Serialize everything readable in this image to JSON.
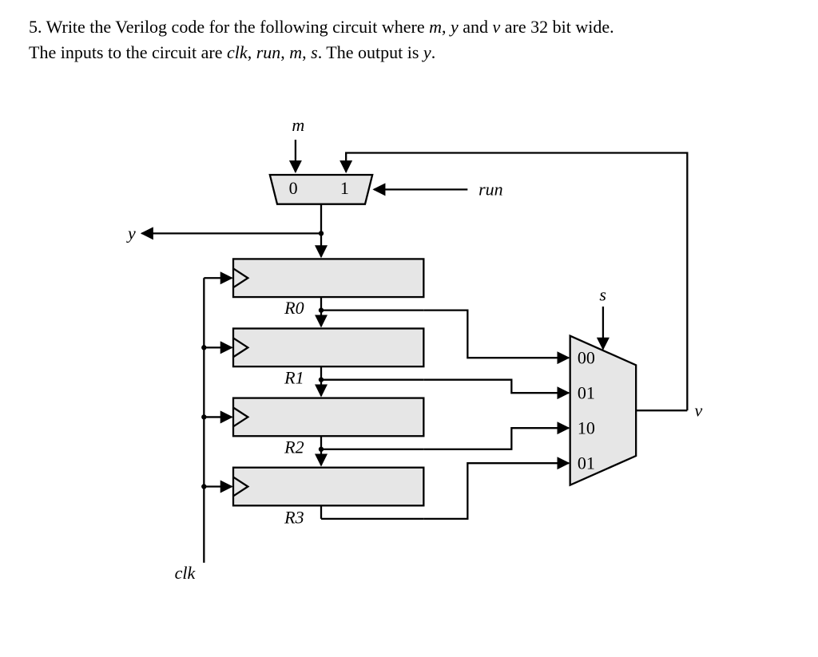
{
  "question": {
    "number": "5.",
    "line1a": "Write the Verilog code for the following circuit where ",
    "vars_m": "m",
    "comma1": ", ",
    "vars_y": "y",
    "and": " and ",
    "vars_v": "v",
    "line1b": " are 32 bit wide.",
    "line2a": "The inputs to the circuit are ",
    "inp_clk": "clk",
    "c2": ", ",
    "inp_run": "run",
    "c3": ", ",
    "inp_m": "m",
    "c4": ", ",
    "inp_s": "s",
    "line2b": ". The output is ",
    "out_y": "y",
    "period": "."
  },
  "diagram": {
    "labels": {
      "m": "m",
      "run": "run",
      "y": "y",
      "s": "s",
      "v": "v",
      "clk": "clk",
      "R0": "R0",
      "R1": "R1",
      "R2": "R2",
      "R3": "R3",
      "mux_top_in0": "0",
      "mux_top_in1": "1",
      "mux_sel_00": "00",
      "mux_sel_01a": "01",
      "mux_sel_10": "10",
      "mux_sel_11_typo": "01"
    }
  },
  "chart_data": {
    "type": "block-diagram",
    "description": "Digital circuit with a 2:1 mux (inputs m and v, select run) feeding y and a chain of four 32-bit registers R0..R3 clocked by clk; R0..R3 outputs feed a 4:1 mux (select s) whose output v feeds back to the 2:1 mux input 1.",
    "signals": {
      "inputs": [
        "clk",
        "run",
        "m",
        "s"
      ],
      "outputs": [
        "y"
      ],
      "width_bits": {
        "m": 32,
        "y": 32,
        "v": 32
      }
    },
    "components": [
      {
        "id": "mux2",
        "type": "mux2to1",
        "in0": "m",
        "in1": "v",
        "sel": "run",
        "out": "y"
      },
      {
        "id": "R0",
        "type": "register",
        "clk": "clk",
        "d": "y",
        "q": "R0"
      },
      {
        "id": "R1",
        "type": "register",
        "clk": "clk",
        "d": "R0",
        "q": "R1"
      },
      {
        "id": "R2",
        "type": "register",
        "clk": "clk",
        "d": "R1",
        "q": "R2"
      },
      {
        "id": "R3",
        "type": "register",
        "clk": "clk",
        "d": "R2",
        "q": "R3"
      },
      {
        "id": "mux4",
        "type": "mux4to1",
        "in00": "R0",
        "in01": "R1",
        "in10": "R2",
        "in11": "R3",
        "sel": "s",
        "out": "v",
        "note": "fourth select label is printed as 01 in the figure"
      }
    ],
    "connections": [
      [
        "m",
        "mux2.in0"
      ],
      [
        "v",
        "mux2.in1"
      ],
      [
        "run",
        "mux2.sel"
      ],
      [
        "mux2.out",
        "y"
      ],
      [
        "mux2.out",
        "R0.d"
      ],
      [
        "R0.q",
        "R1.d"
      ],
      [
        "R0.q",
        "mux4.in00"
      ],
      [
        "R1.q",
        "R2.d"
      ],
      [
        "R1.q",
        "mux4.in01"
      ],
      [
        "R2.q",
        "R3.d"
      ],
      [
        "R2.q",
        "mux4.in10"
      ],
      [
        "R3.q",
        "mux4.in11"
      ],
      [
        "s",
        "mux4.sel"
      ],
      [
        "mux4.out",
        "v"
      ],
      [
        "clk",
        "R0.clk"
      ],
      [
        "clk",
        "R1.clk"
      ],
      [
        "clk",
        "R2.clk"
      ],
      [
        "clk",
        "R3.clk"
      ]
    ]
  }
}
